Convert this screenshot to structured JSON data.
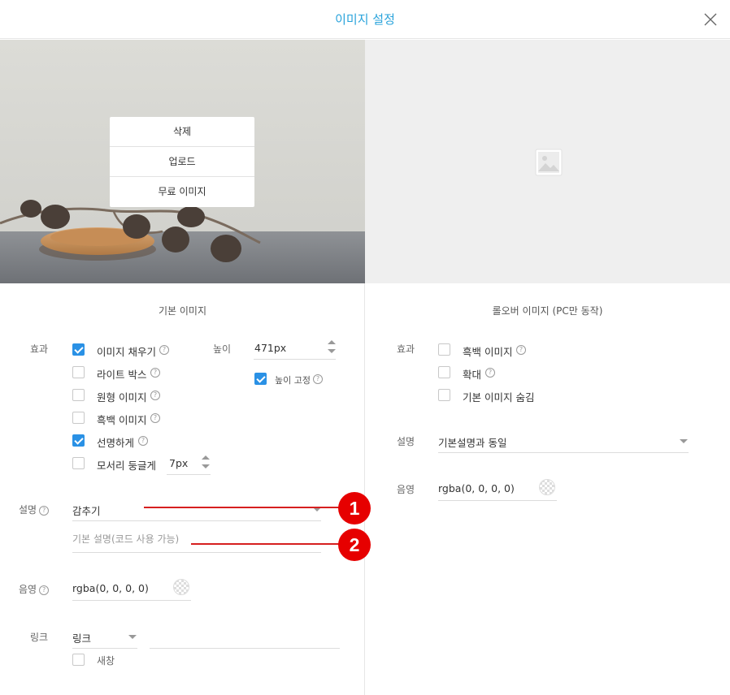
{
  "dialog": {
    "title": "이미지 설정"
  },
  "image_menu": {
    "delete": "삭제",
    "upload": "업로드",
    "free_images": "무료 이미지"
  },
  "basic": {
    "section_title": "기본 이미지",
    "effect_label": "효과",
    "effects": [
      {
        "label": "이미지 채우기",
        "checked": true,
        "help": true
      },
      {
        "label": "라이트 박스",
        "checked": false,
        "help": true
      },
      {
        "label": "원형 이미지",
        "checked": false,
        "help": true
      },
      {
        "label": "흑백 이미지",
        "checked": false,
        "help": true
      },
      {
        "label": "선명하게",
        "checked": true,
        "help": true
      },
      {
        "label": "모서리 둥글게",
        "checked": false,
        "help": false
      }
    ],
    "corner_radius": "7px",
    "height_label": "높이",
    "height_value": "471px",
    "height_fixed_label": "높이 고정",
    "height_fixed_checked": true,
    "caption_label": "설명",
    "caption_value": "감추기",
    "caption_placeholder": "기본 설명(코드 사용 가능)",
    "shadow_label": "음영",
    "shadow_value": "rgba(0, 0, 0, 0)",
    "link_label": "링크",
    "link_type": "링크",
    "new_window_label": "새창",
    "new_window_checked": false
  },
  "rollover": {
    "section_title": "롤오버 이미지 (PC만 동작)",
    "effect_label": "효과",
    "effects": [
      {
        "label": "흑백 이미지",
        "checked": false,
        "help": true
      },
      {
        "label": "확대",
        "checked": false,
        "help": true
      },
      {
        "label": "기본 이미지 숨김",
        "checked": false,
        "help": false
      }
    ],
    "caption_label": "설명",
    "caption_value": "기본설명과 동일",
    "shadow_label": "음영",
    "shadow_value": "rgba(0, 0, 0, 0)"
  },
  "annotations": [
    "1",
    "2"
  ],
  "help_glyph": "?",
  "colors": {
    "accent": "#29a3db",
    "checkbox": "#2a91e5",
    "annotation": "#e60000"
  },
  "icons": [
    "close-icon",
    "image-placeholder-icon",
    "help-icon",
    "color-picker-icon",
    "dropdown-caret-icon",
    "spinner-icon"
  ]
}
